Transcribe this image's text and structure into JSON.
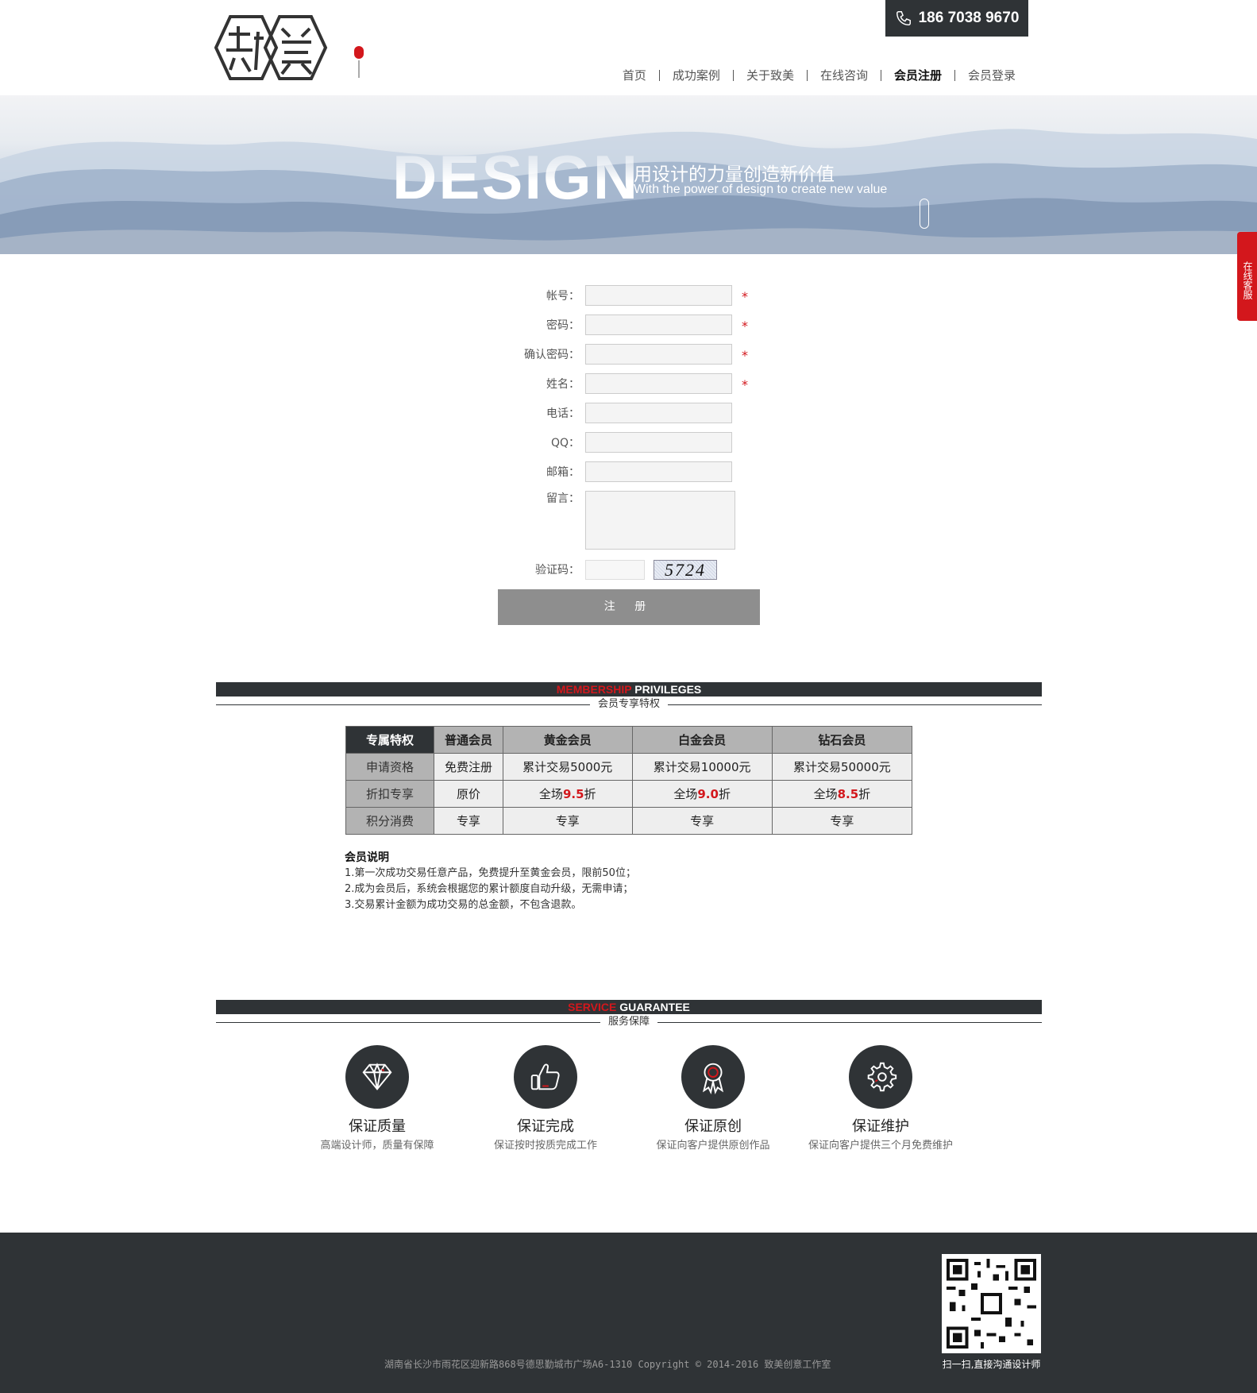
{
  "header": {
    "phone": "186 7038 9670",
    "nav": [
      "首页",
      "成功案例",
      "关于致美",
      "在线咨询",
      "会员注册",
      "会员登录"
    ],
    "active_nav": "会员注册"
  },
  "banner": {
    "big_word": "DESIGN",
    "cn_slogan": "用设计的力量创造新价值",
    "en_slogan": "With the power of design to create new value"
  },
  "side_tab": "在线客服",
  "form": {
    "account_label": "帐号：",
    "password_label": "密码：",
    "confirm_label": "确认密码：",
    "name_label": "姓名：",
    "phone_label": "电话：",
    "qq_label": "QQ：",
    "email_label": "邮箱：",
    "message_label": "留言：",
    "captcha_label": "验证码：",
    "captcha_text": "5724",
    "required_mark": "*",
    "submit_label": "注 册"
  },
  "membership": {
    "title_red": "MEMBERSHIP",
    "title_white": "PRIVILEGES",
    "subtitle": "会员专享特权",
    "headers": [
      "专属特权",
      "普通会员",
      "黄金会员",
      "白金会员",
      "钻石会员"
    ],
    "rows": [
      {
        "label": "申请资格",
        "cells": [
          "免费注册",
          "累计交易5000元",
          "累计交易10000元",
          "累计交易50000元"
        ]
      },
      {
        "label": "折扣专享",
        "cells": [
          {
            "pre": "原价",
            "hl": "",
            "post": ""
          },
          {
            "pre": "全场",
            "hl": "9.5",
            "post": "折"
          },
          {
            "pre": "全场",
            "hl": "9.0",
            "post": "折"
          },
          {
            "pre": "全场",
            "hl": "8.5",
            "post": "折"
          }
        ]
      },
      {
        "label": "积分消费",
        "cells": [
          "专享",
          "专享",
          "专享",
          "专享"
        ]
      }
    ],
    "notes_title": "会员说明",
    "notes": [
      "1.第一次成功交易任意产品，免费提升至黄金会员，限前50位；",
      "2.成为会员后，系统会根据您的累计额度自动升级，无需申请；",
      "3.交易累计金额为成功交易的总金额，不包含退款。"
    ]
  },
  "service": {
    "title_red": "SERVICE",
    "title_white": "GUARANTEE",
    "subtitle": "服务保障",
    "items": [
      {
        "icon": "diamond-icon",
        "title": "保证质量",
        "desc": "高端设计师，质量有保障"
      },
      {
        "icon": "thumbs-up-icon",
        "title": "保证完成",
        "desc": "保证按时按质完成工作"
      },
      {
        "icon": "award-icon",
        "title": "保证原创",
        "desc": "保证向客户提供原创作品"
      },
      {
        "icon": "gear-icon",
        "title": "保证维护",
        "desc": "保证向客户提供三个月免费维护"
      }
    ]
  },
  "footer": {
    "address": "湖南省长沙市雨花区迎新路868号德思勤城市广场A6-1310  Copyright  ©  2014-2016  致美创意工作室",
    "qr_caption": "扫一扫,直接沟通设计师"
  },
  "colors": {
    "accent": "#d3171c",
    "dark": "#2f3336"
  }
}
